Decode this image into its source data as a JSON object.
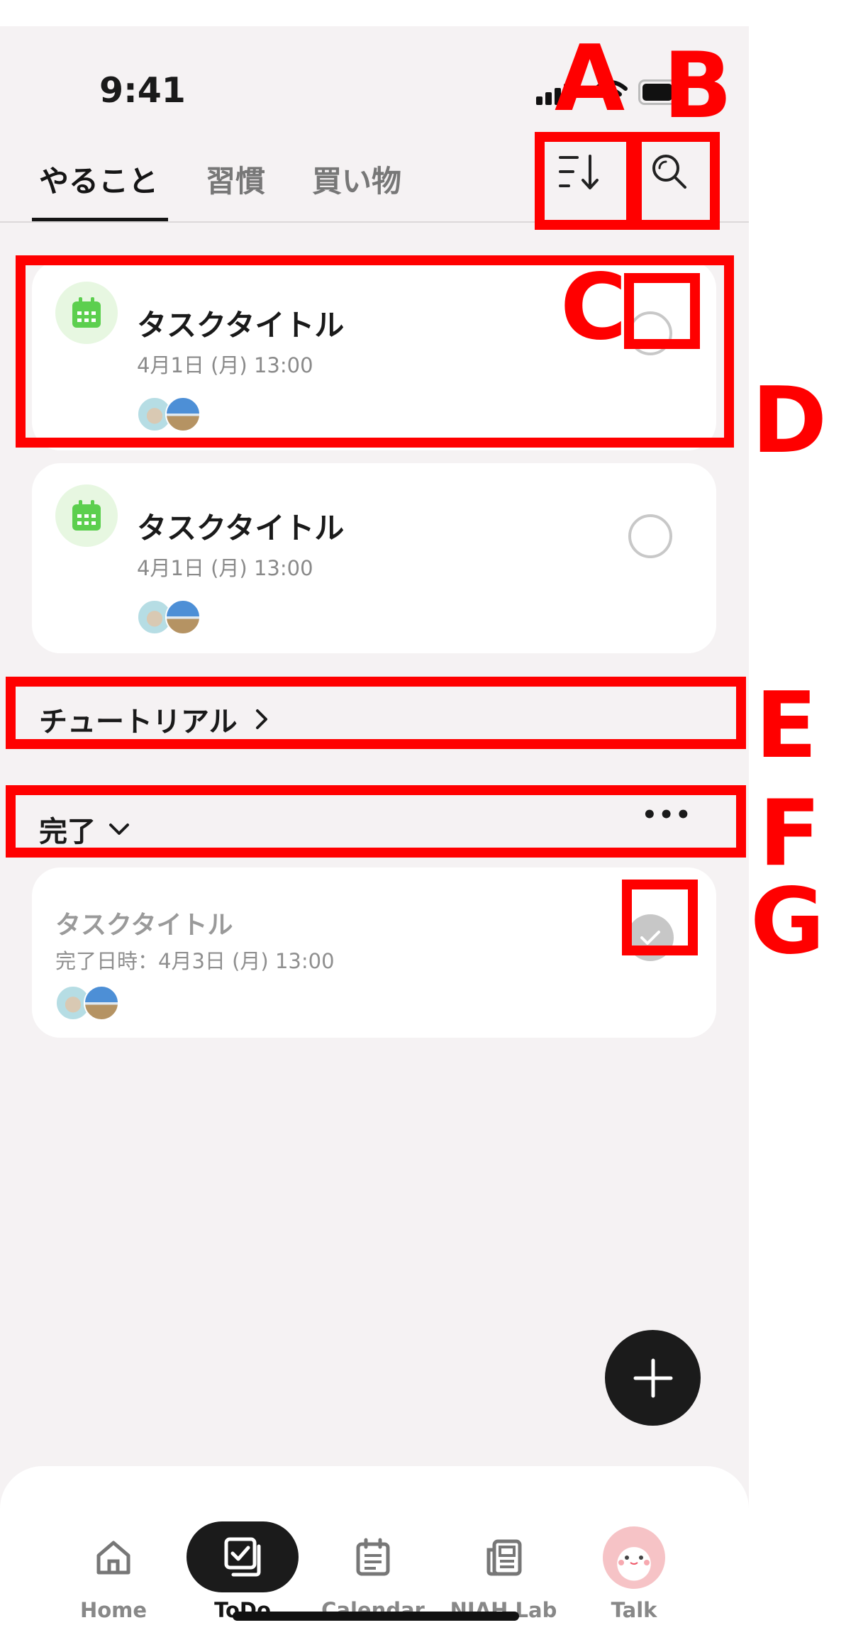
{
  "status_bar": {
    "time": "9:41"
  },
  "tabs": [
    {
      "label": "やること",
      "active": true
    },
    {
      "label": "習慣",
      "active": false
    },
    {
      "label": "買い物",
      "active": false
    }
  ],
  "header_icons": {
    "sort": "sort-icon",
    "search": "search-icon"
  },
  "tasks": [
    {
      "title": "タスクタイトル",
      "date": "4月1日 (月) 13:00",
      "icon": "calendar-icon"
    },
    {
      "title": "タスクタイトル",
      "date": "4月1日 (月) 13:00",
      "icon": "calendar-icon"
    }
  ],
  "tutorial": {
    "label": "チュートリアル"
  },
  "completed": {
    "label": "完了",
    "more": "•••",
    "items": [
      {
        "title": "タスクタイトル",
        "date": "完了日時：4月3日 (月) 13:00"
      }
    ]
  },
  "bottom_nav": [
    {
      "label": "Home",
      "icon": "home-icon",
      "active": false
    },
    {
      "label": "ToDo",
      "icon": "todo-icon",
      "active": true
    },
    {
      "label": "Calendar",
      "icon": "calendar-icon",
      "active": false
    },
    {
      "label": "NIAH Lab",
      "icon": "news-icon",
      "active": false
    },
    {
      "label": "Talk",
      "icon": "talk-avatar-icon",
      "active": false
    }
  ],
  "annotations": [
    "A",
    "B",
    "C",
    "D",
    "E",
    "F",
    "G"
  ],
  "colors": {
    "annotation": "#ff0000",
    "background": "#f5f2f3",
    "calendar_green": "#5ccf4e",
    "accent_dark": "#1b1b1b"
  }
}
